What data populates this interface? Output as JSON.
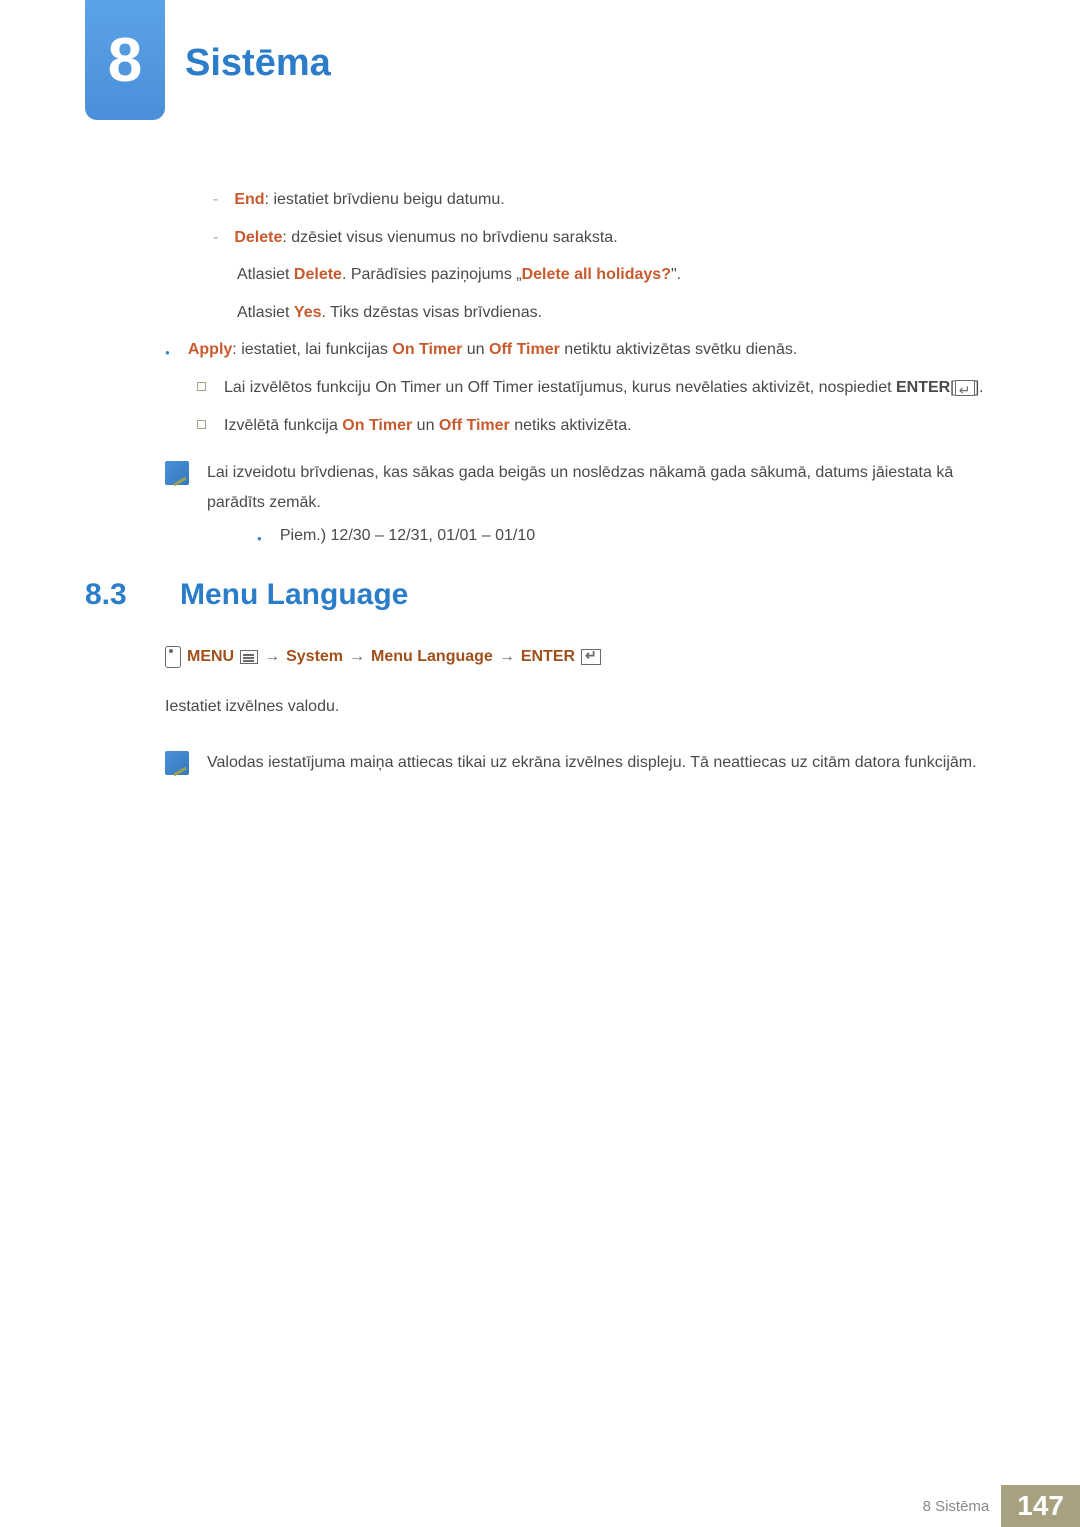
{
  "chapter": {
    "number": "8",
    "title": "Sistēma"
  },
  "content": {
    "end_label": "End",
    "end_text": ": iestatiet brīvdienu beigu datumu.",
    "delete_label": "Delete",
    "delete_text": ": dzēsiet visus vienumus no brīvdienu saraksta.",
    "select_prefix": "Atlasiet ",
    "delete_bold": "Delete",
    "delete_msg_text": ". Parādīsies paziņojums „",
    "delete_all_holidays": "Delete all holidays?",
    "delete_msg_suffix": "\".",
    "yes_bold": "Yes",
    "yes_text": ". Tiks dzēstas visas brīvdienas.",
    "apply_label": "Apply",
    "apply_text_prefix": ": iestatiet, lai funkcijas ",
    "on_timer": "On Timer",
    "apply_text_mid": " un ",
    "off_timer": "Off Timer",
    "apply_text_suffix": " netiktu aktivizētas svētku dienās.",
    "square1_text": "Lai izvēlētos funkciju On Timer un Off Timer iestatījumus, kurus nevēlaties aktivizēt, nospiediet ",
    "enter_label": "ENTER",
    "enter_bracket_open": "[",
    "enter_bracket_close": "].",
    "square2_prefix": "Izvēlētā funkcija ",
    "square2_suffix": " netiks aktivizēta.",
    "note1_text": "Lai izveidotu brīvdienas, kas sākas gada beigās un noslēdzas nākamā gada sākumā, datums jāiestata kā parādīts zemāk.",
    "example_text": "Piem.) 12/30 – 12/31, 01/01 – 01/10"
  },
  "section83": {
    "number": "8.3",
    "title": "Menu Language",
    "nav_menu": "MENU",
    "nav_system": "System",
    "nav_menu_language": "Menu Language",
    "nav_enter": "ENTER",
    "arrow": "→",
    "body": "Iestatiet izvēlnes valodu.",
    "note_text": "Valodas iestatījuma maiņa attiecas tikai uz ekrāna izvēlnes displeju. Tā neattiecas uz citām datora funkcijām."
  },
  "footer": {
    "chapter_ref": "8 Sistēma",
    "page_number": "147"
  }
}
